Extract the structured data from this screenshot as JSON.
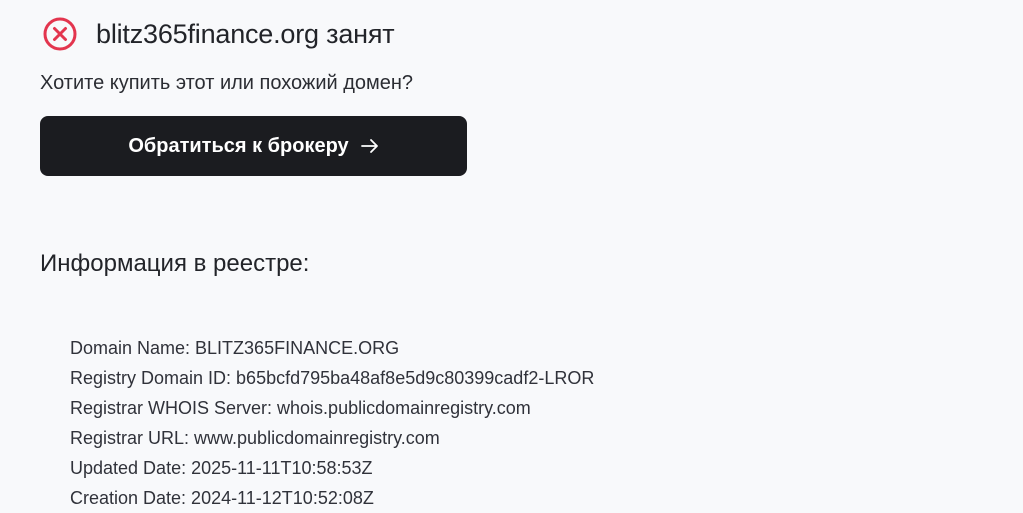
{
  "status": {
    "icon": "x-circle-icon",
    "icon_color": "#e3354e",
    "title": "blitz365finance.org занят"
  },
  "question": "Хотите купить этот или похожий домен?",
  "broker_button": {
    "label": "Обратиться к брокеру",
    "icon": "arrow-right-icon",
    "background": "#1b1c20"
  },
  "registry": {
    "heading": "Информация в реестре:",
    "lines": [
      "Domain Name: BLITZ365FINANCE.ORG",
      "Registry Domain ID: b65bcfd795ba48af8e5d9c80399cadf2-LROR",
      "Registrar WHOIS Server: whois.publicdomainregistry.com",
      "Registrar URL: www.publicdomainregistry.com",
      "Updated Date: 2025-11-11T10:58:53Z",
      "Creation Date: 2024-11-12T10:52:08Z"
    ]
  }
}
